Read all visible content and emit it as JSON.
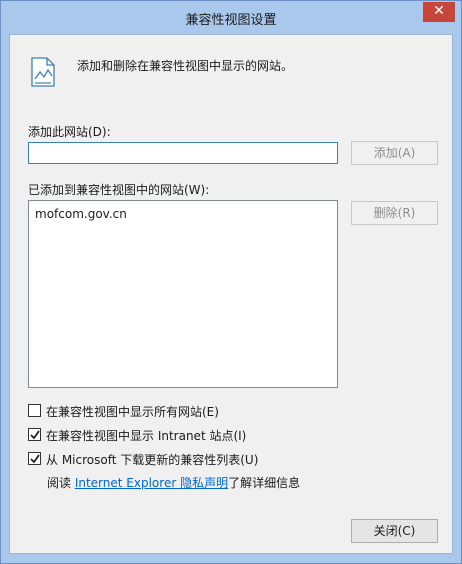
{
  "window": {
    "title": "兼容性视图设置",
    "close_glyph": "✕"
  },
  "info": {
    "icon": "page-icon",
    "text": "添加和删除在兼容性视图中显示的网站。"
  },
  "add_site": {
    "label": "添加此网站(D):",
    "value": "",
    "button": "添加(A)"
  },
  "added_sites": {
    "label": "已添加到兼容性视图中的网站(W):",
    "items": [
      "mofcom.gov.cn"
    ],
    "remove_button": "删除(R)"
  },
  "options": [
    {
      "label": "在兼容性视图中显示所有网站(E)",
      "checked": false
    },
    {
      "label": "在兼容性视图中显示 Intranet 站点(I)",
      "checked": true
    },
    {
      "label": "从 Microsoft 下载更新的兼容性列表(U)",
      "checked": true
    }
  ],
  "read_more": {
    "prefix": "阅读 ",
    "link": "Internet Explorer 隐私声明",
    "suffix": "了解详细信息"
  },
  "close_button": "关闭(C)",
  "colors": {
    "frame": "#aac7ec",
    "client": "#f0f0f0",
    "close_red": "#c7463c",
    "link": "#0066cc"
  }
}
